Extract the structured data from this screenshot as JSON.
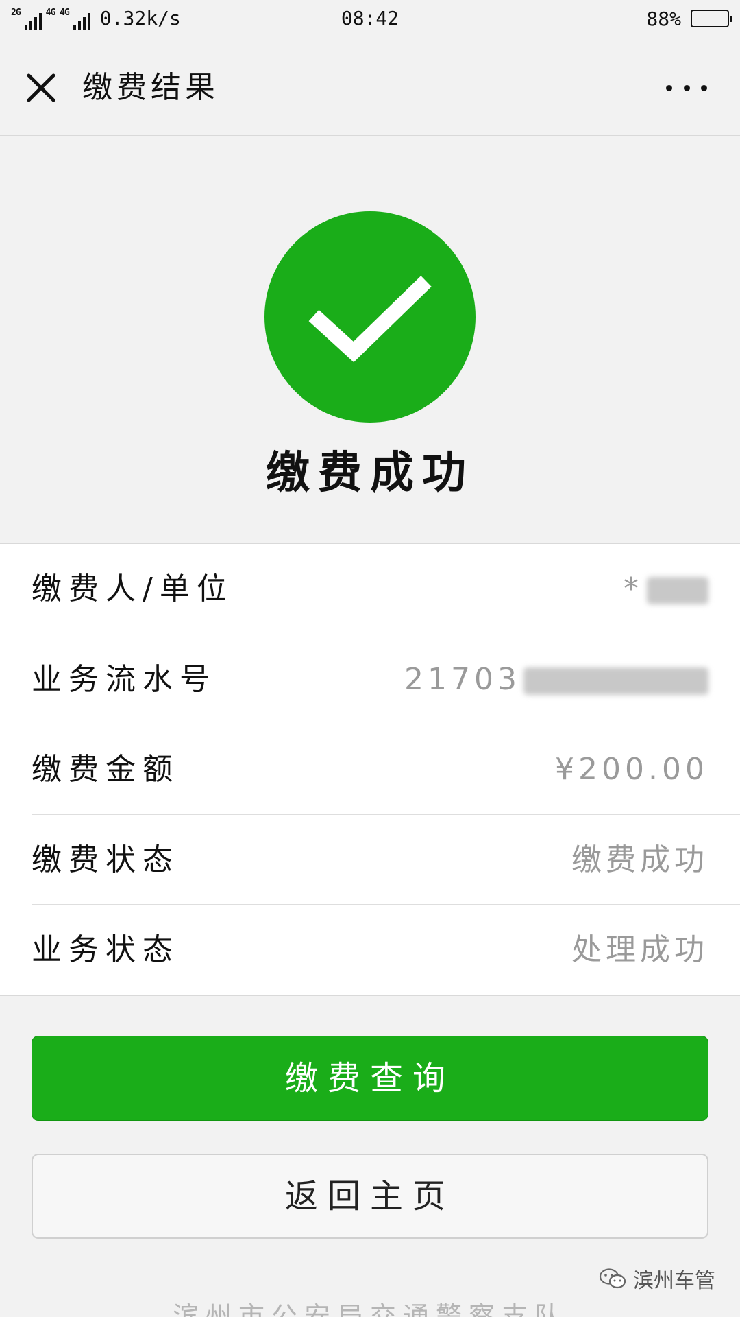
{
  "status_bar": {
    "network_tag_1": "2G",
    "network_tag_2": "4G 4G",
    "net_speed": "0.32k/s",
    "time": "08:42",
    "battery_percent": "88%",
    "battery_level": 0.88
  },
  "nav": {
    "title": "缴费结果",
    "close_icon": "close-icon",
    "more_icon": "more-icon"
  },
  "result": {
    "icon": "success-check-icon",
    "icon_color": "#1aad19",
    "message": "缴费成功"
  },
  "details": [
    {
      "label": "缴费人/单位",
      "value": "*"
    },
    {
      "label": "业务流水号",
      "value": "21703"
    },
    {
      "label": "缴费金额",
      "value": "¥200.00"
    },
    {
      "label": "缴费状态",
      "value": "缴费成功"
    },
    {
      "label": "业务状态",
      "value": "处理成功"
    }
  ],
  "buttons": {
    "primary": "缴费查询",
    "secondary": "返回主页"
  },
  "footer": {
    "agency": "滨州市公安局交通警察支队",
    "watermark": "滨州车管"
  }
}
